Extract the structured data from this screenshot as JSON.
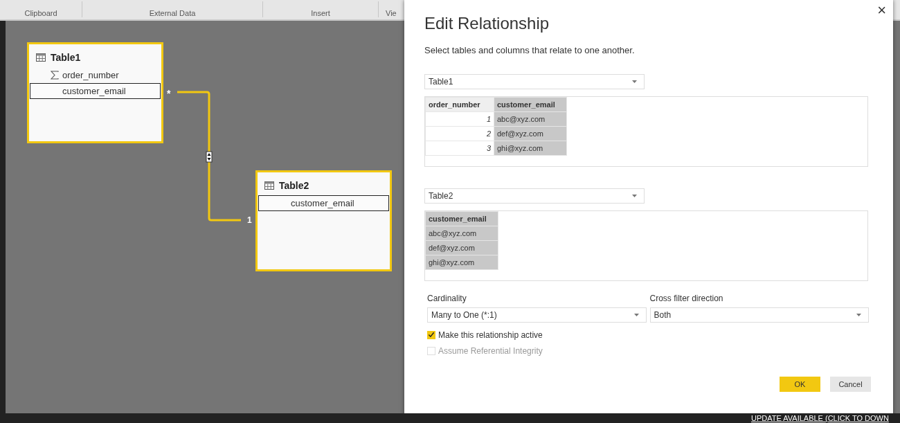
{
  "ribbon": {
    "groups": [
      {
        "label": "Clipboard"
      },
      {
        "label": "External Data"
      },
      {
        "label": "Insert"
      },
      {
        "label": "Vie"
      }
    ]
  },
  "diagram": {
    "tables": [
      {
        "name": "Table1",
        "selected": true,
        "fields": [
          {
            "name": "order_number",
            "kind": "measure",
            "selected": false
          },
          {
            "name": "customer_email",
            "kind": "plain",
            "selected": true
          }
        ]
      },
      {
        "name": "Table2",
        "selected": true,
        "fields": [
          {
            "name": "customer_email",
            "kind": "plain",
            "selected": true
          }
        ]
      }
    ],
    "relationship": {
      "from_label": "*",
      "to_label": "1"
    }
  },
  "dialog": {
    "title": "Edit Relationship",
    "close": "×",
    "subtitle": "Select tables and columns that relate to one another.",
    "sections": [
      {
        "dropdown": "Table1",
        "columns": [
          {
            "name": "order_number",
            "kind": "number",
            "selected": false
          },
          {
            "name": "customer_email",
            "kind": "text",
            "selected": true
          }
        ],
        "rows": [
          [
            "1",
            "abc@xyz.com"
          ],
          [
            "2",
            "def@xyz.com"
          ],
          [
            "3",
            "ghi@xyz.com"
          ]
        ]
      },
      {
        "dropdown": "Table2",
        "columns": [
          {
            "name": "customer_email",
            "kind": "text",
            "selected": true
          }
        ],
        "rows": [
          [
            "abc@xyz.com"
          ],
          [
            "def@xyz.com"
          ],
          [
            "ghi@xyz.com"
          ]
        ]
      }
    ],
    "cardinality": {
      "label": "Cardinality",
      "value": "Many to One (*:1)"
    },
    "cross_filter": {
      "label": "Cross filter direction",
      "value": "Both"
    },
    "checkboxes": [
      {
        "label": "Make this relationship active",
        "checked": true,
        "disabled": false
      },
      {
        "label": "Assume Referential Integrity",
        "checked": false,
        "disabled": true
      }
    ],
    "buttons": [
      {
        "label": "OK",
        "kind": "primary"
      },
      {
        "label": "Cancel",
        "kind": "secondary"
      }
    ]
  },
  "status_bar": {
    "text": "UPDATE AVAILABLE (CLICK TO DOWN"
  }
}
